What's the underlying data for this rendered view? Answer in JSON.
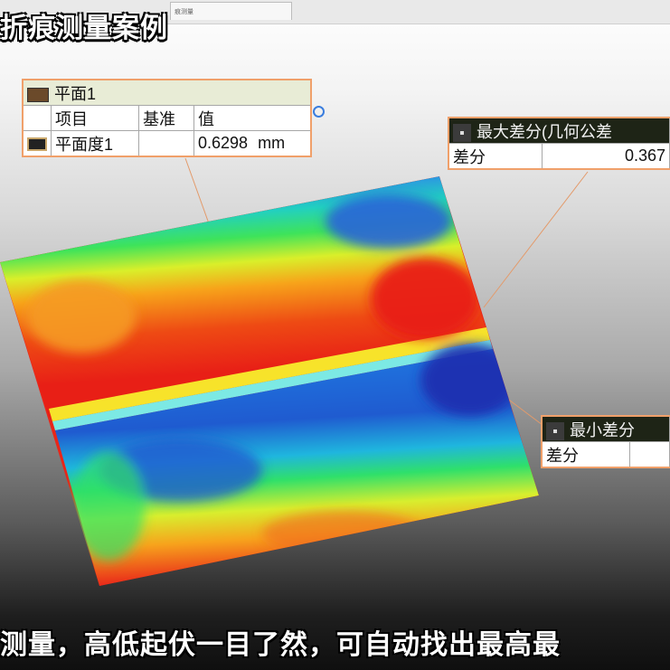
{
  "window": {
    "tab_label": "痕测量"
  },
  "overlay_title": "折痕测量案例",
  "plane_box": {
    "title": "平面1",
    "col_item": "项目",
    "col_base": "基准",
    "col_value": "值",
    "row_name": "平面度1",
    "row_value": "0.6298",
    "row_unit": "mm"
  },
  "max_box": {
    "title": "最大差分(几何公差",
    "row_label": "差分",
    "row_value": "0.367"
  },
  "min_box": {
    "title": "最小差分",
    "row_label": "差分",
    "row_value": ""
  },
  "subtitle": "测量，高低起伏一目了然，可自动找出最高最",
  "icons": {
    "plane": "plane-icon",
    "flatness": "flatness-icon",
    "point": "point-icon",
    "ring": "ring-icon"
  }
}
